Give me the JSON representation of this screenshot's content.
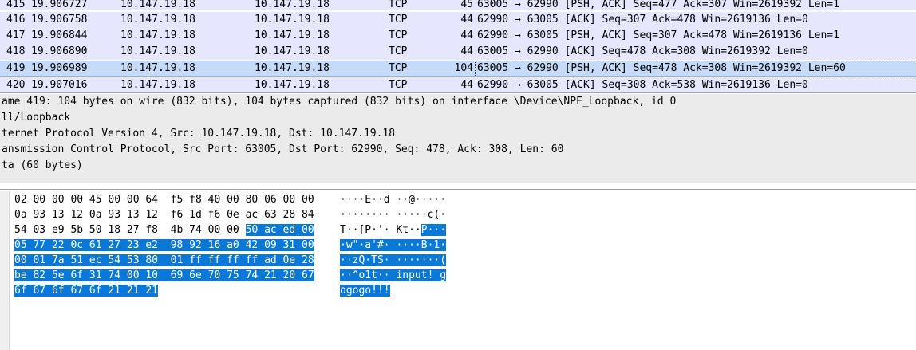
{
  "packet_list": {
    "rows": [
      {
        "no": "415",
        "time": "19.906727",
        "src": "10.147.19.18",
        "dst": "10.147.19.18",
        "proto": "TCP",
        "len": "45",
        "info": "63005 → 62990 [PSH, ACK] Seq=477 Ack=307 Win=2619392 Len=1"
      },
      {
        "no": "416",
        "time": "19.906758",
        "src": "10.147.19.18",
        "dst": "10.147.19.18",
        "proto": "TCP",
        "len": "44",
        "info": "62990 → 63005 [ACK] Seq=307 Ack=478 Win=2619136 Len=0"
      },
      {
        "no": "417",
        "time": "19.906844",
        "src": "10.147.19.18",
        "dst": "10.147.19.18",
        "proto": "TCP",
        "len": "44",
        "info": "62990 → 63005 [PSH, ACK] Seq=307 Ack=478 Win=2619136 Len=1"
      },
      {
        "no": "418",
        "time": "19.906890",
        "src": "10.147.19.18",
        "dst": "10.147.19.18",
        "proto": "TCP",
        "len": "44",
        "info": "63005 → 62990 [ACK] Seq=478 Ack=308 Win=2619392 Len=0"
      },
      {
        "no": "419",
        "time": "19.906989",
        "src": "10.147.19.18",
        "dst": "10.147.19.18",
        "proto": "TCP",
        "len": "104",
        "info": "63005 → 62990 [PSH, ACK] Seq=478 Ack=308 Win=2619392 Len=60"
      },
      {
        "no": "420",
        "time": "19.907016",
        "src": "10.147.19.18",
        "dst": "10.147.19.18",
        "proto": "TCP",
        "len": "44",
        "info": "62990 → 63005 [ACK] Seq=308 Ack=538 Win=2619136 Len=0"
      }
    ]
  },
  "packet_details": {
    "rows": [
      "ame 419: 104 bytes on wire (832 bits), 104 bytes captured (832 bits) on interface \\Device\\NPF_Loopback, id 0",
      "ll/Loopback",
      "ternet Protocol Version 4, Src: 10.147.19.18, Dst: 10.147.19.18",
      "ansmission Control Protocol, Src Port: 63005, Dst Port: 62990, Seq: 478, Ack: 308, Len: 60",
      "ta (60 bytes)"
    ]
  },
  "bytes": {
    "lines": [
      {
        "hex_plain": "02 00 00 00 45 00 00 64  f5 f8 40 00 80 06 00 00",
        "hex_hl": "",
        "ascii_plain": "····E··d ··@·····",
        "ascii_hl": ""
      },
      {
        "hex_plain": "0a 93 13 12 0a 93 13 12  f6 1d f6 0e ac 63 28 84",
        "hex_hl": "",
        "ascii_plain": "········ ·····c(·",
        "ascii_hl": ""
      },
      {
        "hex_plain": "54 03 e9 5b 50 18 27 f8  4b 74 00 00 ",
        "hex_hl": "50 ac ed 00",
        "ascii_plain": "T··[P·'· Kt··",
        "ascii_hl": "P···"
      },
      {
        "hex_plain": "",
        "hex_hl": "05 77 22 0c 61 27 23 e2  98 92 16 a0 42 09 31 00",
        "ascii_plain": "",
        "ascii_hl": "·w\"·a'#· ····B·1·"
      },
      {
        "hex_plain": "",
        "hex_hl": "00 01 7a 51 ec 54 53 80  01 ff ff ff ff ad 0e 28",
        "ascii_plain": "",
        "ascii_hl": "··zQ·TS· ·······("
      },
      {
        "hex_plain": "",
        "hex_hl": "be 82 5e 6f 31 74 00 10  69 6e 70 75 74 21 20 67",
        "ascii_plain": "",
        "ascii_hl": "··^o1t·· input! g"
      },
      {
        "hex_plain": "",
        "hex_hl": "6f 67 6f 67 6f 21 21 21",
        "ascii_plain": "",
        "ascii_hl": "ogogo!!!"
      }
    ]
  },
  "colors": {
    "row_tcp": "#e7e6ff",
    "row_selected": "#c6dbf7",
    "details_bg": "#ebebeb",
    "byte_highlight": "#0a78d7"
  }
}
